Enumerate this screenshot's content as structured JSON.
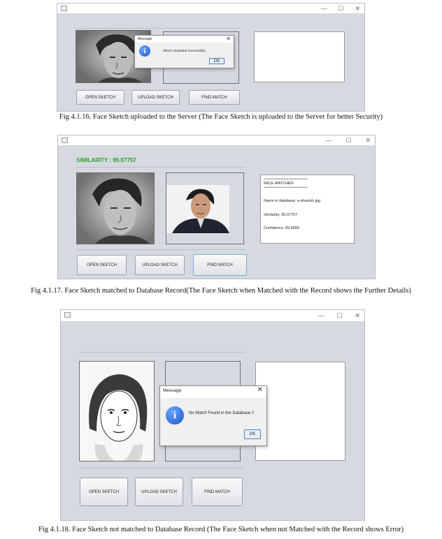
{
  "fig1": {
    "buttons": {
      "open": "OPEN SKETCH",
      "upload": "UPLOAD SKETCH",
      "find": "FIND MATCH"
    },
    "dialog": {
      "title": "Message",
      "message": "Sketch Uploaded Successfully",
      "ok": "OK"
    },
    "caption": "Fig 4.1.16. Face Sketch uploaded to the Server (The Face Sketch is uploaded to the Server for better Security)"
  },
  "fig2": {
    "similarity_header": "SIMILARITY : 95.97757",
    "result": {
      "stars1": "**********************************************",
      "status": "FACE MATCHED",
      "stars2": "**********************************************",
      "name_line": "Name in database: a-sharukh.jpg",
      "similarity_line": "Similarity: 95.97757",
      "confidence_line": "Confidence: 99.9999"
    },
    "buttons": {
      "open": "OPEN SKETCH",
      "upload": "UPLOAD SKETCH",
      "find": "FIND MATCH"
    },
    "caption": "Fig 4.1.17. Face Sketch matched to Database Record(The Face Sketch when Matched with the Record shows the Further Details)"
  },
  "fig3": {
    "buttons": {
      "open": "OPEN SKETCH",
      "upload": "UPLOAD SKETCH",
      "find": "FIND MATCH"
    },
    "dialog": {
      "title": "Message",
      "message": "No Match Found in the Database !!",
      "ok": "OK"
    },
    "caption": "Fig 4.1.18. Face Sketch not matched to Database Record (The Face Sketch when not Matched with the Record shows Error)"
  },
  "colors": {
    "window_bg": "#d6d9e0",
    "similarity_green": "#2ca02c",
    "info_blue": "#1b55c9"
  },
  "icons": {
    "info": "i",
    "close": "✕",
    "minimize": "—",
    "maximize": "☐"
  }
}
